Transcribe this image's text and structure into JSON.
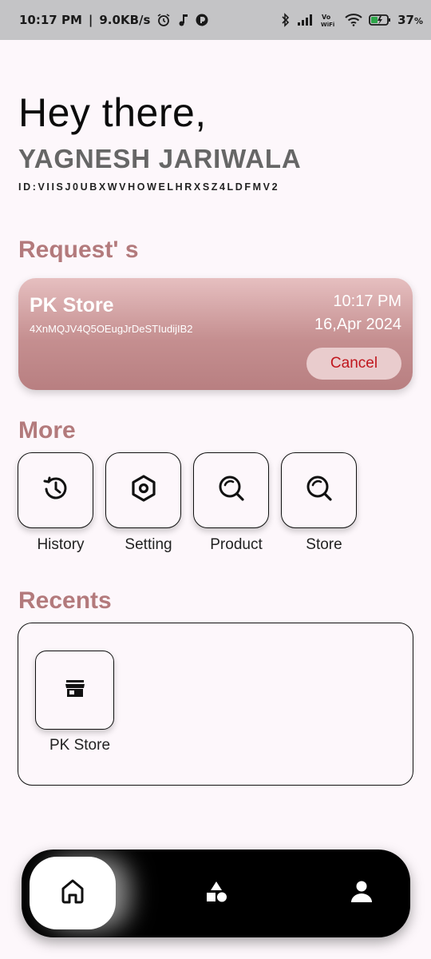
{
  "status_bar": {
    "time": "10:17 PM",
    "speed": "9.0KB/s",
    "battery": "37"
  },
  "greeting": "Hey there,",
  "user": {
    "name": "YAGNESH JARIWALA",
    "id": "ID:VIISJ0UBXWVHOWELHRXSZ4LDFMV2"
  },
  "requests": {
    "title": "Request' s",
    "items": [
      {
        "store": "PK Store",
        "code": "4XnMQJV4Q5OEugJrDeSTIudijIB2",
        "time": "10:17 PM",
        "date": "16,Apr 2024",
        "cancel_label": "Cancel"
      }
    ]
  },
  "more": {
    "title": "More",
    "items": [
      {
        "label": "History",
        "icon": "history-icon"
      },
      {
        "label": "Setting",
        "icon": "settings-icon"
      },
      {
        "label": "Product",
        "icon": "search-icon"
      },
      {
        "label": "Store",
        "icon": "search-icon"
      }
    ]
  },
  "recents": {
    "title": "Recents",
    "items": [
      {
        "label": "PK Store",
        "icon": "store-icon"
      }
    ]
  },
  "nav": {
    "items": [
      {
        "name": "home",
        "icon": "home-icon",
        "active": true
      },
      {
        "name": "categories",
        "icon": "shapes-icon",
        "active": false
      },
      {
        "name": "profile",
        "icon": "person-icon",
        "active": false
      }
    ]
  },
  "colors": {
    "accent": "#b37a7c",
    "card_gradient_top": "#e6bfc0",
    "card_gradient_bottom": "#b87f81",
    "cancel_text": "#c0161d",
    "background": "#fdf7fb"
  }
}
